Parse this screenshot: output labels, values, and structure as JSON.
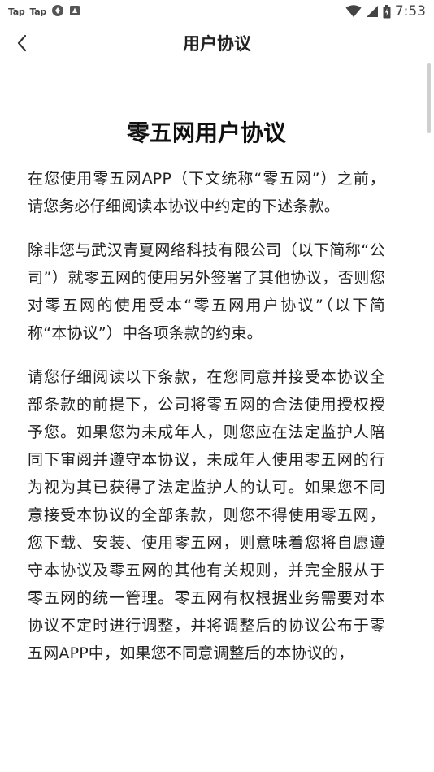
{
  "status_bar": {
    "apps": [
      "Tap",
      "Tap"
    ],
    "time": "7:53",
    "icons": [
      "taptap-icon",
      "taptap-icon",
      "sync-icon",
      "notification-icon",
      "wifi-icon",
      "signal-icon",
      "battery-icon"
    ]
  },
  "header": {
    "title": "用户协议",
    "back_icon": "chevron-left-icon"
  },
  "document": {
    "title": "零五网用户协议",
    "paragraphs": [
      "在您使用零五网APP（下文统称“零五网”）之前，请您务必仔细阅读本协议中约定的下述条款。",
      "除非您与武汉青夏网络科技有限公司（以下简称“公司”）就零五网的使用另外签署了其他协议，否则您对零五网的使用受本“零五网用户协议”（以下简称“本协议”）中各项条款的约束。",
      "请您仔细阅读以下条款，在您同意并接受本协议全部条款的前提下，公司将零五网的合法使用授权授予您。如果您为未成年人，则您应在法定监护人陪同下审阅并遵守本协议，未成年人使用零五网的行为视为其已获得了法定监护人的认可。如果您不同意接受本协议的全部条款，则您不得使用零五网，您下载、安装、使用零五网，则意味着您将自愿遵守本协议及零五网的其他有关规则，并完全服从于零五网的统一管理。零五网有权根据业务需要对本协议不定时进行调整，并将调整后的协议公布于零五网APP中，如果您不同意调整后的本协议的，"
    ]
  }
}
